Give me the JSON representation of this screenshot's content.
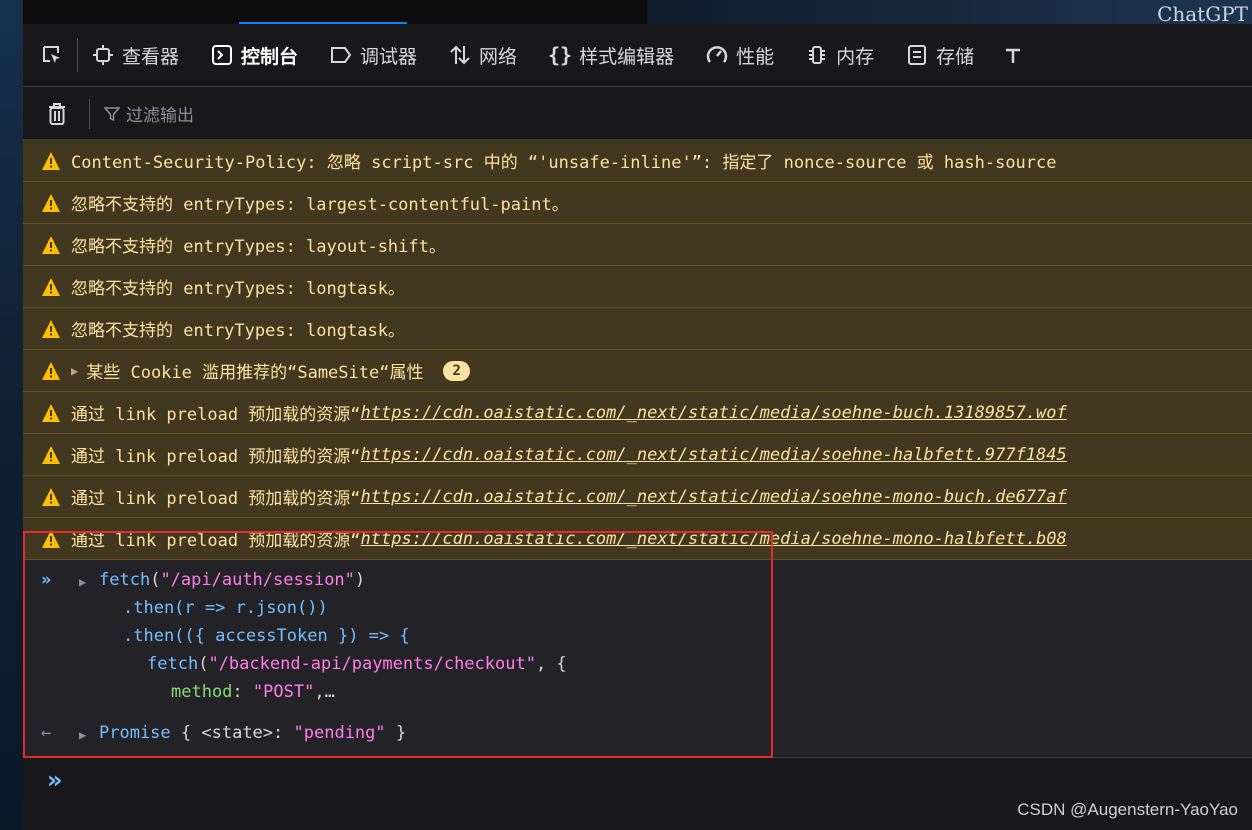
{
  "window": {
    "title_fragment": "ChatGPT"
  },
  "toolbar": {
    "tabs": [
      {
        "label": "查看器",
        "icon": "inspector-icon"
      },
      {
        "label": "控制台",
        "icon": "console-icon",
        "active": true
      },
      {
        "label": "调试器",
        "icon": "debugger-icon"
      },
      {
        "label": "网络",
        "icon": "network-icon"
      },
      {
        "label": "样式编辑器",
        "icon": "style-editor-icon"
      },
      {
        "label": "性能",
        "icon": "performance-icon"
      },
      {
        "label": "内存",
        "icon": "memory-icon"
      },
      {
        "label": "存储",
        "icon": "storage-icon"
      }
    ]
  },
  "filterbar": {
    "placeholder": "过滤输出"
  },
  "warnings": [
    {
      "text": "Content-Security-Policy: 忽略 script-src 中的 “'unsafe-inline'”: 指定了 nonce-source 或 hash-source"
    },
    {
      "text": "忽略不支持的 entryTypes: largest-contentful-paint。"
    },
    {
      "text": "忽略不支持的 entryTypes: layout-shift。"
    },
    {
      "text": "忽略不支持的 entryTypes: longtask。"
    },
    {
      "text": "忽略不支持的 entryTypes: longtask。"
    },
    {
      "text": "某些 Cookie 滥用推荐的“SameSite“属性",
      "badge": "2",
      "expandable": true
    },
    {
      "prefix": "通过 link preload 预加载的资源“",
      "link": "https://cdn.oaistatic.com/_next/static/media/soehne-buch.13189857.wof"
    },
    {
      "prefix": "通过 link preload 预加载的资源“",
      "link": "https://cdn.oaistatic.com/_next/static/media/soehne-halbfett.977f1845"
    },
    {
      "prefix": "通过 link preload 预加载的资源“",
      "link": "https://cdn.oaistatic.com/_next/static/media/soehne-mono-buch.de677af"
    },
    {
      "prefix": "通过 link preload 预加载的资源“",
      "link": "https://cdn.oaistatic.com/_next/static/media/soehne-mono-halbfett.b08"
    }
  ],
  "console_input": {
    "line1_fn": "fetch",
    "line1_str": "\"/api/auth/session\"",
    "line2": ".then(r => r.json())",
    "line3_pre": ".then(({ ",
    "line3_token": "accessToken",
    "line3_post": " }) => {",
    "line4_fn": "fetch",
    "line4_str": "\"/backend-api/payments/checkout\"",
    "line4_post": ", {",
    "line5_prop": "method",
    "line5_str": "\"POST\"",
    "line5_post": ",…"
  },
  "console_output": {
    "type": "Promise",
    "state_key": "<state>",
    "state_value": "\"pending\""
  },
  "watermark": "CSDN @Augenstern-YaoYao"
}
